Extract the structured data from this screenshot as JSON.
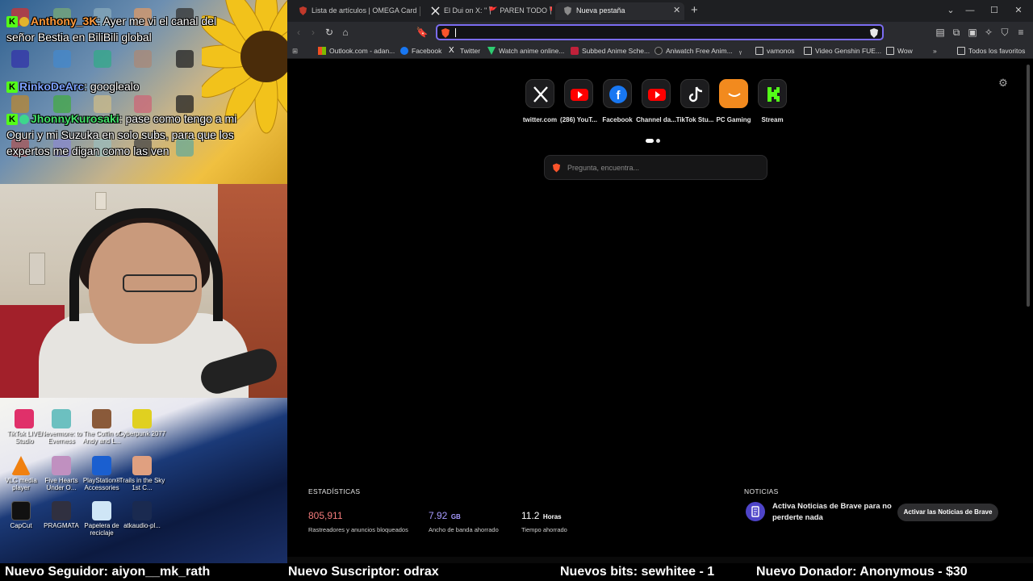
{
  "overlay": {
    "chat": [
      {
        "user": "Anthony_3K",
        "text": ": Ayer me vi el canal del señor Bestia en BiliBili global"
      },
      {
        "user": "RinkoDeArc",
        "text": ": googlealo"
      },
      {
        "user": "JhonnyKurosaki",
        "text": ": pase como tengo a mi Oguri y mi Suzuka en solo subs, para que los expertos me digan como las ven"
      }
    ],
    "desktop_icons": [
      {
        "label": "TikTok LIVE Studio"
      },
      {
        "label": "Nevermore: to Everness"
      },
      {
        "label": "The Coffin of Andy and L..."
      },
      {
        "label": "Cyberpunk 2077"
      },
      {
        "label": "VLC media player"
      },
      {
        "label": "Five Hearts Under O..."
      },
      {
        "label": "PlayStation® Accessories"
      },
      {
        "label": "Trails in the Sky 1st C..."
      },
      {
        "label": "CapCut"
      },
      {
        "label": "PRAGMATA"
      },
      {
        "label": "Papelera de reciclaje"
      },
      {
        "label": "atkaudio-pl..."
      }
    ]
  },
  "browser": {
    "tabs": [
      {
        "title": "Lista de artículos | OMEGA Card Gam",
        "active": false
      },
      {
        "title": "El Dui on X: \" 🚩 PAREN TODO 🚩 Bi",
        "active": false
      },
      {
        "title": "Nueva pestaña",
        "active": true
      }
    ],
    "new_tab_label": "+",
    "url_value": "",
    "bookmarks": [
      {
        "label": "Outlook.com - adan..."
      },
      {
        "label": "Facebook"
      },
      {
        "label": "Twitter"
      },
      {
        "label": "Watch anime online..."
      },
      {
        "label": "Subbed Anime Sche..."
      },
      {
        "label": "Aniwatch Free Anim..."
      },
      {
        "label": ""
      },
      {
        "label": "vamonos"
      },
      {
        "label": "Video Genshin FUE..."
      },
      {
        "label": "Wow"
      },
      {
        "label": "Todos los favoritos"
      }
    ],
    "top_sites": [
      {
        "label": "twitter.com",
        "icon": "x-logo-icon"
      },
      {
        "label": "(286) YouT...",
        "icon": "youtube-icon"
      },
      {
        "label": "Facebook",
        "icon": "facebook-icon"
      },
      {
        "label": "Channel da...",
        "icon": "youtube-icon"
      },
      {
        "label": "TikTok Stu...",
        "icon": "tiktok-icon"
      },
      {
        "label": "PC Gaming",
        "icon": "pc-gaming-icon"
      },
      {
        "label": "Stream",
        "icon": "kick-icon"
      }
    ],
    "search_placeholder": "Pregunta, encuentra...",
    "stats": {
      "title": "ESTADÍSTICAS",
      "trackers_value": "805,911",
      "trackers_label": "Rastreadores y anuncios bloqueados",
      "bandwidth_value": "7.92",
      "bandwidth_unit": "GB",
      "bandwidth_label": "Ancho de banda ahorrado",
      "time_value": "11.2",
      "time_unit": "Horas",
      "time_label": "Tiempo ahorrado"
    },
    "news": {
      "title": "NOTICIAS",
      "text": "Activa Noticias de Brave para no perderte nada",
      "button": "Activar las Noticias de Brave"
    }
  },
  "ticker": {
    "follower": "Nuevo Seguidor: aiyon__mk_rath",
    "subscriber": "Nuevo Suscriptor: odrax",
    "bits": "Nuevos bits: sewhitee - 1",
    "donor": "Nuevo Donador: Anonymous - $30"
  },
  "colors": {
    "accent_purple": "#7b6cf0",
    "trackers_red": "#f47c7c",
    "bandwidth_purple": "#a79bff",
    "brave_orange": "#fb542b",
    "kick_green": "#53fc18"
  }
}
